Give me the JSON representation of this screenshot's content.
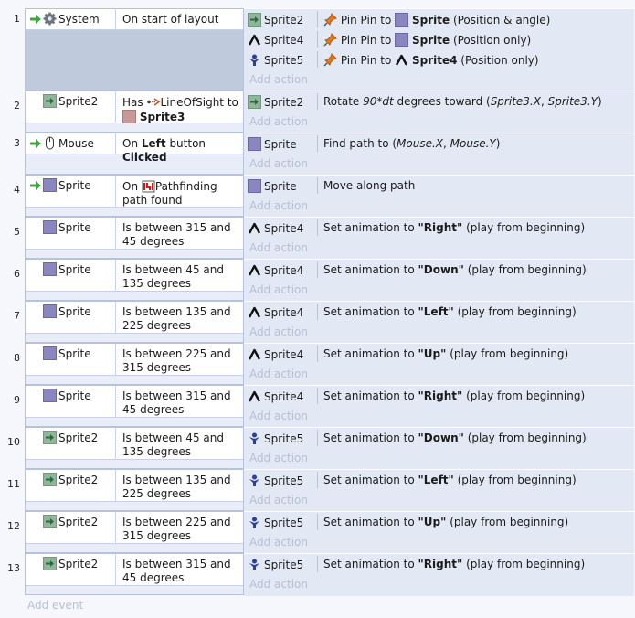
{
  "add_action_label": "Add action",
  "add_event_label": "Add event",
  "events": [
    {
      "num": "1",
      "cond": {
        "object": "System",
        "icon": "gear-icon",
        "parts": [
          {
            "t": "On start of layout"
          }
        ]
      },
      "actions": [
        {
          "object": "Sprite2",
          "icon": "sprite2-icon",
          "parts": [
            {
              "t": "Pin Pin to "
            },
            {
              "t": "Sprite",
              "b": true
            },
            {
              "t": " (Position & angle)"
            }
          ],
          "pin": true,
          "target_icon": "sprite-icon"
        },
        {
          "object": "Sprite4",
          "icon": "sprite4-icon",
          "parts": [
            {
              "t": "Pin Pin to "
            },
            {
              "t": "Sprite",
              "b": true
            },
            {
              "t": " (Position only)"
            }
          ],
          "pin": true,
          "target_icon": "sprite-icon"
        },
        {
          "object": "Sprite5",
          "icon": "sprite5-icon",
          "parts": [
            {
              "t": "Pin Pin to "
            },
            {
              "t": "Sprite4",
              "b": true
            },
            {
              "t": " (Position only)"
            }
          ],
          "pin": true,
          "target_icon": "sprite4-icon"
        }
      ]
    },
    {
      "num": "2",
      "cond": {
        "object": "Sprite2",
        "icon": "sprite2-icon",
        "parts": [
          {
            "t": "Has "
          },
          {
            "t": "LineOfSight to"
          },
          {
            "t": "Sprite3",
            "b": true
          }
        ],
        "special": "los"
      },
      "actions": [
        {
          "object": "Sprite2",
          "icon": "sprite2-icon",
          "parts": [
            {
              "t": "Rotate "
            },
            {
              "t": "90*dt",
              "i": true
            },
            {
              "t": "  degrees toward ("
            },
            {
              "t": "Sprite3.X",
              "i": true
            },
            {
              "t": ", "
            },
            {
              "t": "Sprite3.Y",
              "i": true
            },
            {
              "t": ")"
            }
          ]
        }
      ]
    },
    {
      "num": "3",
      "cond": {
        "object": "Mouse",
        "icon": "mouse-icon",
        "parts": [
          {
            "t": "On "
          },
          {
            "t": "Left",
            "b": true
          },
          {
            "t": " button "
          },
          {
            "t": "Clicked",
            "b": true
          }
        ]
      },
      "actions": [
        {
          "object": "Sprite",
          "icon": "sprite-icon",
          "parts": [
            {
              "t": "Find path to ("
            },
            {
              "t": "Mouse.X",
              "i": true
            },
            {
              "t": ", "
            },
            {
              "t": "Mouse.Y",
              "i": true
            },
            {
              "t": ")"
            }
          ]
        }
      ]
    },
    {
      "num": "4",
      "cond": {
        "object": "Sprite",
        "icon": "sprite-icon",
        "parts": [
          {
            "t": "On "
          },
          {
            "t": "Pathfinding path found"
          }
        ],
        "special": "path"
      },
      "actions": [
        {
          "object": "Sprite",
          "icon": "sprite-icon",
          "parts": [
            {
              "t": "Move along path"
            }
          ]
        }
      ]
    },
    {
      "num": "5",
      "cond": {
        "object": "Sprite",
        "icon": "sprite-icon",
        "parts": [
          {
            "t": "Is between 315 and 45 degrees"
          }
        ]
      },
      "actions": [
        {
          "object": "Sprite4",
          "icon": "sprite4-icon",
          "parts": [
            {
              "t": "Set animation to "
            },
            {
              "t": "\"Right\"",
              "b": true
            },
            {
              "t": " (play from beginning)"
            }
          ]
        }
      ]
    },
    {
      "num": "6",
      "cond": {
        "object": "Sprite",
        "icon": "sprite-icon",
        "parts": [
          {
            "t": "Is between 45 and 135 degrees"
          }
        ]
      },
      "actions": [
        {
          "object": "Sprite4",
          "icon": "sprite4-icon",
          "parts": [
            {
              "t": "Set animation to "
            },
            {
              "t": "\"Down\"",
              "b": true
            },
            {
              "t": " (play from beginning)"
            }
          ]
        }
      ]
    },
    {
      "num": "7",
      "cond": {
        "object": "Sprite",
        "icon": "sprite-icon",
        "parts": [
          {
            "t": "Is between 135 and 225 degrees"
          }
        ]
      },
      "actions": [
        {
          "object": "Sprite4",
          "icon": "sprite4-icon",
          "parts": [
            {
              "t": "Set animation to "
            },
            {
              "t": "\"Left\"",
              "b": true
            },
            {
              "t": " (play from beginning)"
            }
          ]
        }
      ]
    },
    {
      "num": "8",
      "cond": {
        "object": "Sprite",
        "icon": "sprite-icon",
        "parts": [
          {
            "t": "Is between 225 and 315 degrees"
          }
        ]
      },
      "actions": [
        {
          "object": "Sprite4",
          "icon": "sprite4-icon",
          "parts": [
            {
              "t": "Set animation to "
            },
            {
              "t": "\"Up\"",
              "b": true
            },
            {
              "t": " (play from beginning)"
            }
          ]
        }
      ]
    },
    {
      "num": "9",
      "cond": {
        "object": "Sprite",
        "icon": "sprite-icon",
        "parts": [
          {
            "t": "Is between 315 and 45 degrees"
          }
        ]
      },
      "actions": [
        {
          "object": "Sprite4",
          "icon": "sprite4-icon",
          "parts": [
            {
              "t": "Set animation to "
            },
            {
              "t": "\"Right\"",
              "b": true
            },
            {
              "t": " (play from beginning)"
            }
          ]
        }
      ]
    },
    {
      "num": "10",
      "cond": {
        "object": "Sprite2",
        "icon": "sprite2-icon",
        "parts": [
          {
            "t": "Is between 45 and 135 degrees"
          }
        ]
      },
      "actions": [
        {
          "object": "Sprite5",
          "icon": "sprite5-icon",
          "parts": [
            {
              "t": "Set animation to "
            },
            {
              "t": "\"Down\"",
              "b": true
            },
            {
              "t": " (play from beginning)"
            }
          ]
        }
      ]
    },
    {
      "num": "11",
      "cond": {
        "object": "Sprite2",
        "icon": "sprite2-icon",
        "parts": [
          {
            "t": "Is between 135 and 225 degrees"
          }
        ]
      },
      "actions": [
        {
          "object": "Sprite5",
          "icon": "sprite5-icon",
          "parts": [
            {
              "t": "Set animation to "
            },
            {
              "t": "\"Left\"",
              "b": true
            },
            {
              "t": " (play from beginning)"
            }
          ]
        }
      ]
    },
    {
      "num": "12",
      "cond": {
        "object": "Sprite2",
        "icon": "sprite2-icon",
        "parts": [
          {
            "t": "Is between 225 and 315 degrees"
          }
        ]
      },
      "actions": [
        {
          "object": "Sprite5",
          "icon": "sprite5-icon",
          "parts": [
            {
              "t": "Set animation to "
            },
            {
              "t": "\"Up\"",
              "b": true
            },
            {
              "t": " (play from beginning)"
            }
          ]
        }
      ]
    },
    {
      "num": "13",
      "cond": {
        "object": "Sprite2",
        "icon": "sprite2-icon",
        "parts": [
          {
            "t": "Is between 315 and 45 degrees"
          }
        ]
      },
      "actions": [
        {
          "object": "Sprite5",
          "icon": "sprite5-icon",
          "parts": [
            {
              "t": "Set animation to "
            },
            {
              "t": "\"Right\"",
              "b": true
            },
            {
              "t": " (play from beginning)"
            }
          ]
        }
      ]
    }
  ]
}
